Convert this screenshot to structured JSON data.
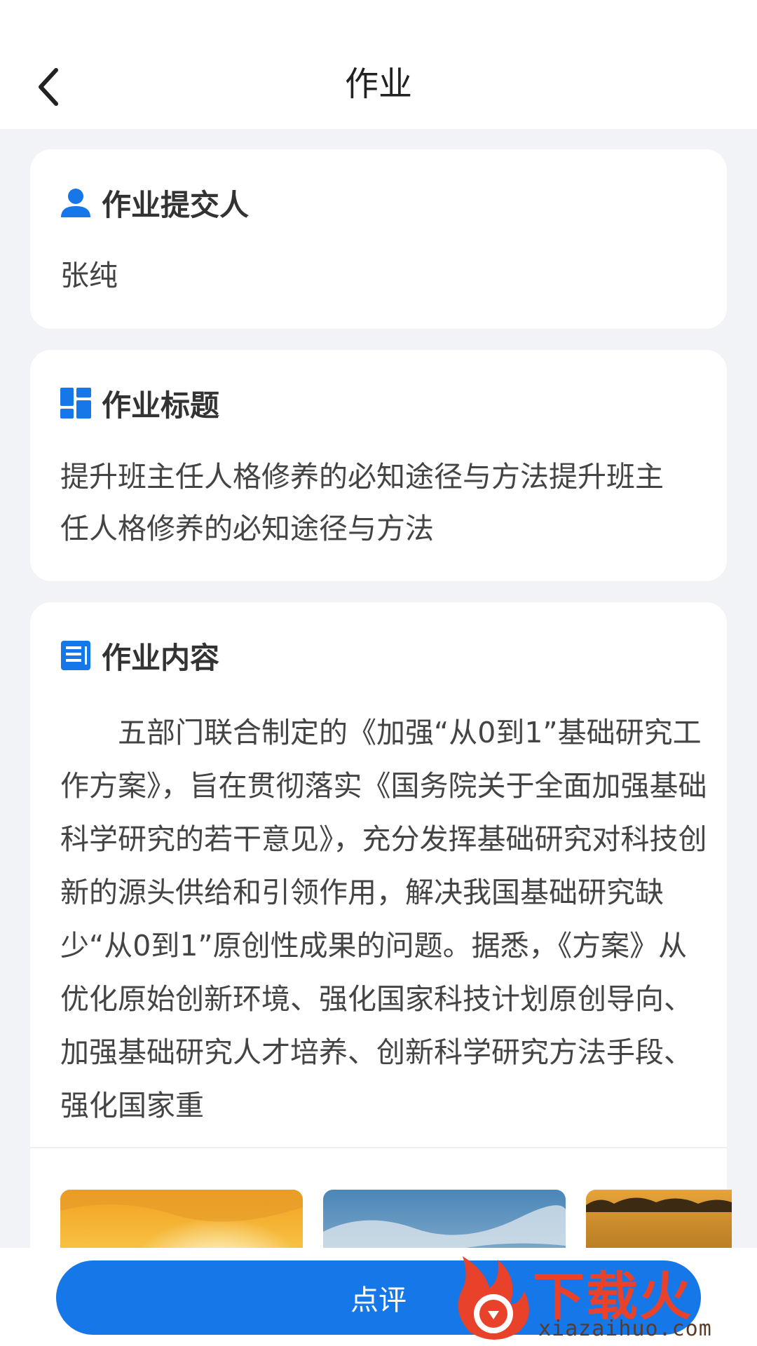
{
  "header": {
    "title": "作业"
  },
  "submitter": {
    "heading": "作业提交人",
    "name": "张纯"
  },
  "hw_title": {
    "heading": "作业标题",
    "text": "提升班主任人格修养的必知途径与方法提升班主任人格修养的必知途径与方法"
  },
  "content": {
    "heading": "作业内容",
    "text": "五部门联合制定的《加强“从0到1”基础研究工作方案》，旨在贯彻落实《国务院关于全面加强基础科学研究的若干意见》，充分发挥基础研究对科技创新的源头供给和引领作用，解决我国基础研究缺少“从0到1”原创性成果的问题。据悉，《方案》从优化原始创新环境、强化国家科技计划原创导向、加强基础研究人才培养、创新科学研究方法手段、强化国家重"
  },
  "actions": {
    "review_label": "点评"
  },
  "watermark": {
    "brand": "下载火",
    "url": "xiazaihuo.com"
  },
  "colors": {
    "accent": "#1677e8",
    "background": "#f2f3f7",
    "watermark": "#e8422b"
  }
}
